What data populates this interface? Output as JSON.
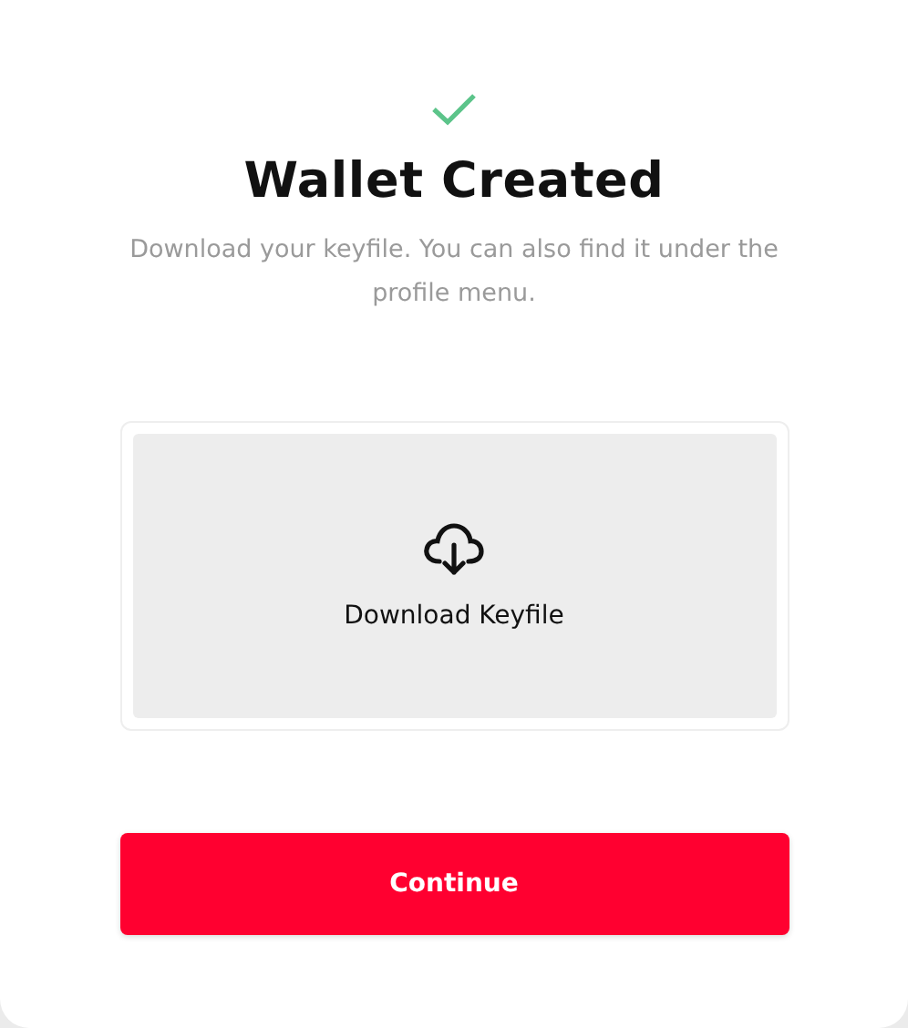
{
  "dialog": {
    "title": "Wallet Created",
    "description": "Download your keyfile. You can also find it under the profile menu.",
    "download": {
      "label": "Download Keyfile"
    },
    "buttons": [
      "Continue"
    ]
  }
}
